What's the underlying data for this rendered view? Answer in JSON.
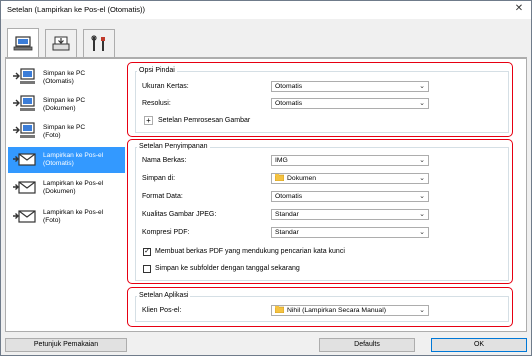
{
  "window": {
    "title": "Setelan (Lampirkan ke Pos-el (Otomatis))",
    "close_glyph": "✕"
  },
  "tabs": [
    {
      "icon": "computer-icon"
    },
    {
      "icon": "scanner-icon"
    },
    {
      "icon": "tools-icon"
    }
  ],
  "sidebar": {
    "items": [
      {
        "line1": "Simpan ke PC",
        "line2": "(Otomatis)",
        "icon": "save-to-pc-icon"
      },
      {
        "line1": "Simpan ke PC",
        "line2": "(Dokumen)",
        "icon": "save-to-pc-icon"
      },
      {
        "line1": "Simpan ke PC",
        "line2": "(Foto)",
        "icon": "save-to-pc-icon"
      },
      {
        "line1": "Lampirkan ke Pos-el",
        "line2": "(Otomatis)",
        "icon": "email-icon",
        "selected": true
      },
      {
        "line1": "Lampirkan ke Pos-el",
        "line2": "(Dokumen)",
        "icon": "email-icon"
      },
      {
        "line1": "Lampirkan ke Pos-el",
        "line2": "(Foto)",
        "icon": "email-icon"
      }
    ]
  },
  "scan_options": {
    "title": "Opsi Pindai",
    "paper_size_label": "Ukuran Kertas:",
    "paper_size_value": "Otomatis",
    "resolution_label": "Resolusi:",
    "resolution_value": "Otomatis",
    "image_processing_label": "Setelan Pemrosesan Gambar",
    "expand_glyph": "+"
  },
  "save_settings": {
    "title": "Setelan Penyimpanan",
    "file_name_label": "Nama Berkas:",
    "file_name_value": "IMG",
    "save_in_label": "Simpan di:",
    "save_in_value": "Dokumen",
    "data_format_label": "Format Data:",
    "data_format_value": "Otomatis",
    "jpeg_quality_label": "Kualitas Gambar JPEG:",
    "jpeg_quality_value": "Standar",
    "pdf_compression_label": "Kompresi PDF:",
    "pdf_compression_value": "Standar",
    "searchable_pdf_label": "Membuat berkas PDF yang mendukung pencarian kata kunci",
    "searchable_pdf_checked": true,
    "subfolder_label": "Simpan ke subfolder dengan tanggal sekarang",
    "subfolder_checked": false,
    "check_glyph": "✓"
  },
  "app_settings": {
    "title": "Setelan Aplikasi",
    "email_client_label": "Klien Pos-el:",
    "email_client_value": "Nihil (Lampirkan Secara Manual)"
  },
  "dropdown_arrow": "⌄",
  "buttons": {
    "guide": "Petunjuk Pemakaian",
    "defaults": "Defaults",
    "ok": "OK"
  },
  "colors": {
    "highlight": "#3399ff",
    "red_outline": "#e60012",
    "folder": "#f5c342"
  }
}
